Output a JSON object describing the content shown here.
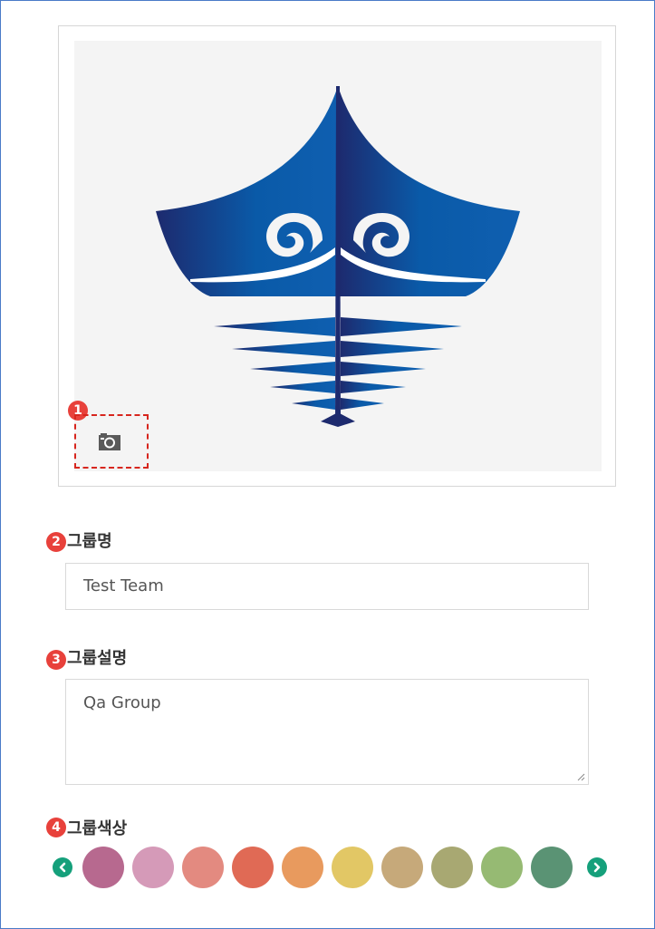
{
  "markers": [
    "1",
    "2",
    "3",
    "4"
  ],
  "group_name": {
    "label": "그룹명",
    "value": "Test Team"
  },
  "group_description": {
    "label": "그룹설명",
    "value": "Qa Group"
  },
  "group_color": {
    "label": "그룹색상",
    "swatches": [
      "#b7698f",
      "#d59ab8",
      "#e38a80",
      "#e06a55",
      "#e89a5e",
      "#e2c765",
      "#c6a97a",
      "#a8a872",
      "#96ba73",
      "#5a9374"
    ]
  },
  "colors": {
    "frame_border": "#4a7bc8",
    "marker": "#e8413b",
    "highlight": "#d7261e",
    "arrow": "#15a07b",
    "logo_blue": "#0a5aa8",
    "logo_navy": "#1d2a6e"
  },
  "icons": [
    "camera-icon",
    "chevron-left-icon",
    "chevron-right-icon",
    "resize-handle-icon"
  ]
}
